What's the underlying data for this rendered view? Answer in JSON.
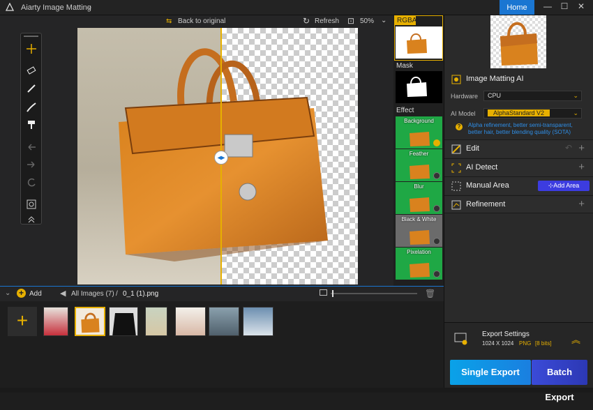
{
  "app": {
    "title": "Aiarty Image Matting",
    "home_label": "Home"
  },
  "canvas_toolbar": {
    "back_label": "Back to original",
    "refresh_label": "Refresh",
    "zoom": "50%"
  },
  "side_strip": {
    "rgba_label": "RGBA",
    "mask_label": "Mask",
    "effect_label": "Effect",
    "effects": [
      "Background",
      "Feather",
      "Blur",
      "Black & White",
      "Pixelation"
    ]
  },
  "right_panel": {
    "matting_title": "Image Matting AI",
    "hardware_label": "Hardware",
    "hardware_value": "CPU",
    "model_label": "AI Model",
    "model_value": "AlphaStandard  V2",
    "model_desc": "Alpha refinement, better semi-transparent, better hair, better blending quality  (SOTA)",
    "edit_label": "Edit",
    "detect_label": "AI Detect",
    "manual_label": "Manual Area",
    "add_area_label": "Add Area",
    "refine_label": "Refinement"
  },
  "export": {
    "title": "Export Settings",
    "size": "1024 X 1024",
    "format": "PNG",
    "bits": "[8 bits]",
    "single_label": "Single Export",
    "batch_label": "Batch Export"
  },
  "bottom": {
    "add_label": "Add",
    "all_images": "All Images (7)",
    "path_sep": "/",
    "file_name": "0_1 (1).png",
    "zoom_slider_value": 0.02
  },
  "colors": {
    "accent": "#1a76d2",
    "highlight": "#e7b000",
    "green": "#1fa845",
    "export_a": "#0aa2e8",
    "export_b": "#3b4bd8"
  }
}
